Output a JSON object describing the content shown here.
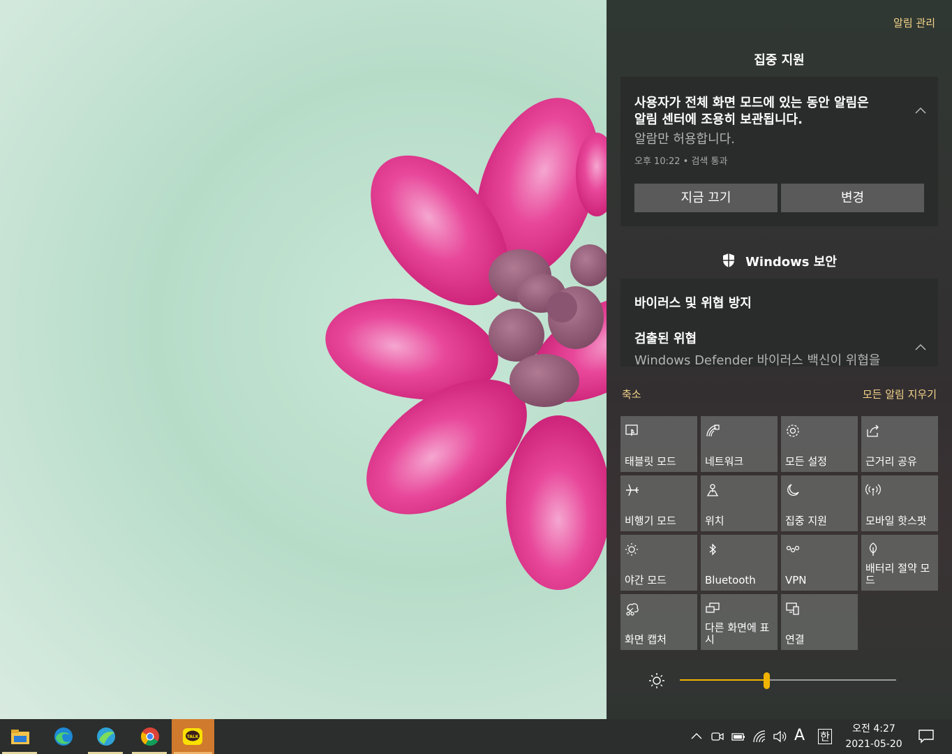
{
  "action_center": {
    "manage_notifications": "알림 관리",
    "focus_section_title": "집중 지원",
    "focus_notification": {
      "line1": "사용자가 전체 화면 모드에 있는 동안 알림은",
      "line2": "알림 센터에 조용히 보관됩니다.",
      "subtitle": "알람만 허용합니다.",
      "meta": "오후 10:22 • 검색 통과",
      "btn_off": "지금 끄기",
      "btn_change": "변경"
    },
    "security_section_title": "Windows 보안",
    "security_notification": {
      "title": "바이러스 및 위협 방지",
      "heading": "검출된 위협",
      "body": "Windows Defender 바이러스 백신이 위협을"
    },
    "collapse": "축소",
    "clear_all": "모든 알림 지우기",
    "tiles": [
      {
        "label": "태블릿 모드",
        "icon": "tablet-mode-icon"
      },
      {
        "label": "네트워크",
        "icon": "network-icon"
      },
      {
        "label": "모든 설정",
        "icon": "settings-gear-icon"
      },
      {
        "label": "근거리 공유",
        "icon": "nearby-share-icon"
      },
      {
        "label": "비행기 모드",
        "icon": "airplane-icon"
      },
      {
        "label": "위치",
        "icon": "location-icon"
      },
      {
        "label": "집중 지원",
        "icon": "moon-icon"
      },
      {
        "label": "모바일 핫스팟",
        "icon": "hotspot-icon"
      },
      {
        "label": "야간 모드",
        "icon": "night-light-icon"
      },
      {
        "label": "Bluetooth",
        "icon": "bluetooth-icon"
      },
      {
        "label": "VPN",
        "icon": "vpn-icon"
      },
      {
        "label": "배터리 절약 모드",
        "icon": "battery-saver-icon"
      },
      {
        "label": "화면 캡처",
        "icon": "screen-snip-icon"
      },
      {
        "label": "다른 화면에 표시",
        "icon": "project-icon"
      },
      {
        "label": "연결",
        "icon": "connect-icon"
      }
    ],
    "brightness": 0.4
  },
  "taskbar": {
    "apps": [
      "file-explorer",
      "edge",
      "whale-browser",
      "chrome",
      "kakaotalk"
    ],
    "ime_mode": "A",
    "ime_lang": "한",
    "clock_time": "오전 4:27",
    "clock_date": "2021-05-20"
  }
}
